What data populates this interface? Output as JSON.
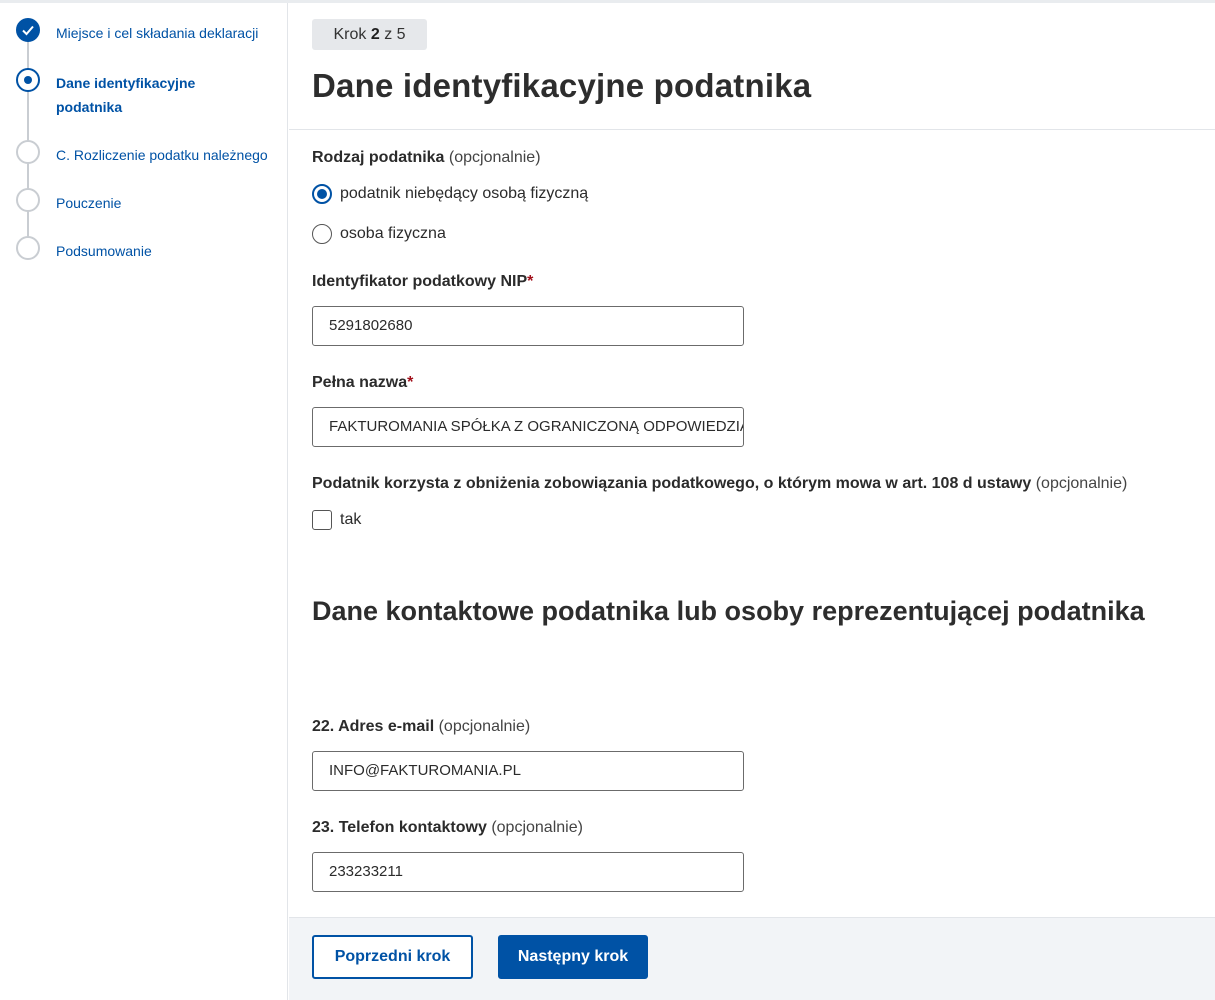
{
  "sidebar": {
    "steps": [
      {
        "label": "Miejsce i cel składania deklaracji",
        "state": "done"
      },
      {
        "label": "Dane identyfikacyjne podatnika",
        "state": "current"
      },
      {
        "label": "C. Rozliczenie podatku należnego",
        "state": "todo"
      },
      {
        "label": "Pouczenie",
        "state": "todo"
      },
      {
        "label": "Podsumowanie",
        "state": "todo"
      }
    ]
  },
  "header": {
    "step_prefix": "Krok",
    "step_current": "2",
    "step_of": "z 5",
    "title": "Dane identyfikacyjne podatnika"
  },
  "form": {
    "taxpayer_type": {
      "label": "Rodzaj podatnika",
      "optional": "(opcjonalnie)",
      "options": [
        {
          "label": "podatnik niebędący osobą fizyczną",
          "checked": true
        },
        {
          "label": "osoba fizyczna",
          "checked": false
        }
      ]
    },
    "nip": {
      "label": "Identyfikator podatkowy NIP",
      "required_mark": "*",
      "value": "5291802680"
    },
    "full_name": {
      "label": "Pełna nazwa",
      "required_mark": "*",
      "value": "FAKTUROMANIA SPÓŁKA Z OGRANICZONĄ ODPOWIEDZIALNOŚCIĄ"
    },
    "reduction": {
      "label": "Podatnik korzysta z obniżenia zobowiązania podatkowego, o którym mowa w art. 108 d ustawy",
      "optional": "(opcjonalnie)",
      "checkbox_label": "tak",
      "checked": false
    }
  },
  "contact": {
    "title": "Dane kontaktowe podatnika lub osoby reprezentującej podatnika",
    "email": {
      "label": "22. Adres e-mail",
      "optional": "(opcjonalnie)",
      "value": "INFO@FAKTUROMANIA.PL"
    },
    "phone": {
      "label": "23. Telefon kontaktowy",
      "optional": "(opcjonalnie)",
      "value": "233233211"
    }
  },
  "footer": {
    "prev_label": "Poprzedni krok",
    "next_label": "Następny krok"
  },
  "colors": {
    "accent": "#0052a5",
    "required": "#a10f1a"
  }
}
